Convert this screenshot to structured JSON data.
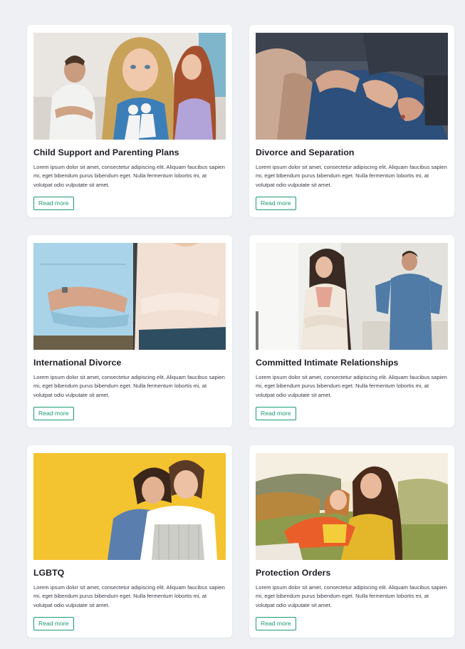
{
  "cards": [
    {
      "title": "Child Support and Parenting Plans",
      "text": "Lorem ipsum dolor sit amet, consectetur adipiscing elit. Aliquam faucibus sapien mi, eget bibendum purus bibendum eget. Nulla fermentum lobortis mi, at volutpat odio vulputate sit amet.",
      "button": "Read more",
      "image": "family-child-parents-photo"
    },
    {
      "title": "Divorce and Separation",
      "text": "Lorem ipsum dolor sit amet, consectetur adipiscing elit. Aliquam faucibus sapien mi, eget bibendum purus bibendum eget. Nulla fermentum lobortis mi, at volutpat odio vulputate sit amet.",
      "button": "Read more",
      "image": "couple-hands-arguing-photo"
    },
    {
      "title": "International Divorce",
      "text": "Lorem ipsum dolor sit amet, consectetur adipiscing elit. Aliquam faucibus sapien mi, eget bibendum purus bibendum eget. Nulla fermentum lobortis mi, at volutpat odio vulputate sit amet.",
      "button": "Read more",
      "image": "couple-arms-crossed-photo"
    },
    {
      "title": "Committed Intimate Relationships",
      "text": "Lorem ipsum dolor sit amet, consectetur adipiscing elit. Aliquam faucibus sapien mi, eget bibendum purus bibendum eget. Nulla fermentum lobortis mi, at volutpat odio vulputate sit amet.",
      "button": "Read more",
      "image": "couple-argument-home-photo"
    },
    {
      "title": "LGBTQ",
      "text": "Lorem ipsum dolor sit amet, consectetur adipiscing elit. Aliquam faucibus sapien mi, eget bibendum purus bibendum eget. Nulla fermentum lobortis mi, at volutpat odio vulputate sit amet.",
      "button": "Read more",
      "image": "two-women-hugging-yellow-photo"
    },
    {
      "title": "Protection Orders",
      "text": "Lorem ipsum dolor sit amet, consectetur adipiscing elit. Aliquam faucibus sapien mi, eget bibendum purus bibendum eget. Nulla fermentum lobortis mi, at volutpat odio vulputate sit amet.",
      "button": "Read more",
      "image": "mother-daughter-hug-outdoors-photo"
    }
  ],
  "colors": {
    "accent": "#1a9b73",
    "background": "#eef0f4",
    "card": "#ffffff",
    "title": "#1d1d26"
  }
}
